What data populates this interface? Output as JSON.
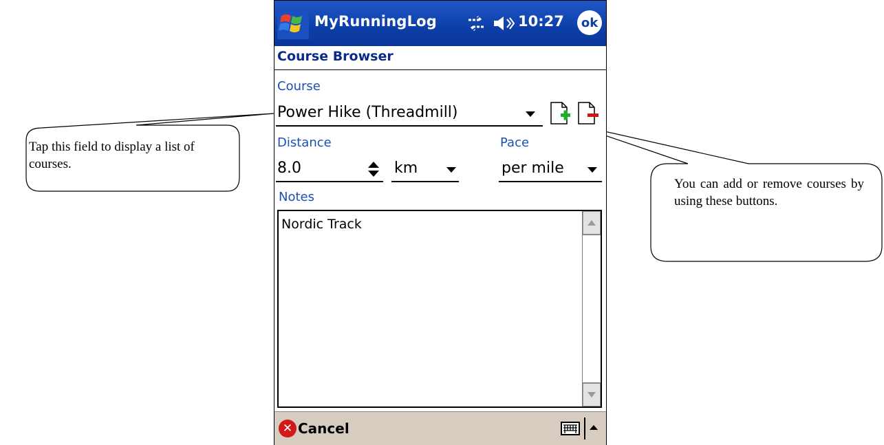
{
  "window": {
    "app_title": "MyRunningLog",
    "clock": "10:27",
    "ok_label": "ok",
    "start_icon": "windows-flag-icon",
    "connectivity_icon": "connectivity-icon",
    "volume_icon": "volume-icon"
  },
  "page": {
    "title": "Course Browser"
  },
  "form": {
    "course_label": "Course",
    "course_value": "Power Hike (Threadmill)",
    "add_course_icon": "add-document-icon",
    "remove_course_icon": "remove-document-icon",
    "distance_label": "Distance",
    "distance_value": "8.0",
    "unit_value": "km",
    "pace_label": "Pace",
    "pace_value": "per mile",
    "notes_label": "Notes",
    "notes_value": "Nordic Track"
  },
  "menu_bar": {
    "cancel_label": "Cancel",
    "keyboard_icon": "keyboard-icon"
  },
  "callouts": {
    "left": "Tap this field to display a list of courses.",
    "right": "You can add or remove courses by using these buttons."
  },
  "colors": {
    "title_bar": "#0d3fa8",
    "label_blue": "#1b4fb5",
    "menu_bar": "#d6ccc0",
    "cancel_red": "#d21818",
    "add_green": "#1fae2a",
    "remove_red": "#d01515"
  }
}
